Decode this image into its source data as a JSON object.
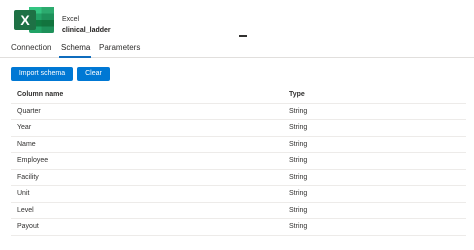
{
  "header": {
    "app_type": "Excel",
    "dataset_name": "clinical_ladder",
    "icon": "excel-icon",
    "icon_color": "#1e7145",
    "icon_letter": "X"
  },
  "tabs": [
    {
      "label": "Connection",
      "selected": false
    },
    {
      "label": "Schema",
      "selected": true
    },
    {
      "label": "Parameters",
      "selected": false
    }
  ],
  "actions": {
    "import_label": "Import schema",
    "clear_label": "Clear"
  },
  "table": {
    "columns": [
      "Column name",
      "Type"
    ],
    "rows": [
      {
        "name": "Quarter",
        "type": "String"
      },
      {
        "name": "Year",
        "type": "String"
      },
      {
        "name": "Name",
        "type": "String"
      },
      {
        "name": "Employee",
        "type": "String"
      },
      {
        "name": "Facility",
        "type": "String"
      },
      {
        "name": "Unit",
        "type": "String"
      },
      {
        "name": "Level",
        "type": "String"
      },
      {
        "name": "Payout",
        "type": "String"
      }
    ]
  },
  "colors": {
    "accent": "#0078d4",
    "excel_green": "#1e7145"
  }
}
